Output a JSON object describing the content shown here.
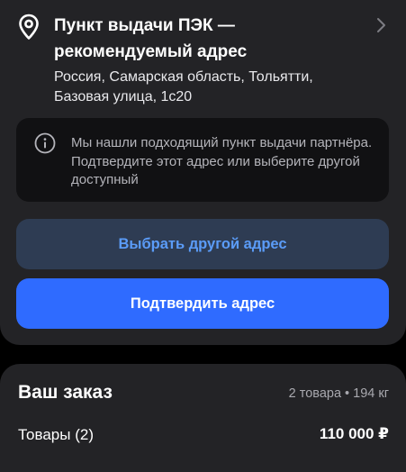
{
  "pickup": {
    "title": "Пункт выдачи ПЭК — рекомендуемый адрес",
    "address": "Россия, Самарская область, Тольятти, Базовая улица, 1с20",
    "icons": {
      "location": "map-pin-icon",
      "navigate": "chevron-right-icon"
    }
  },
  "notice": {
    "icon": "info-icon",
    "text": "Мы нашли подходящий пункт выдачи партнёра. Подтвердите этот адрес или выберите другой доступный"
  },
  "buttons": {
    "choose_other": "Выбрать другой адрес",
    "confirm": "Подтвердить адрес"
  },
  "order": {
    "title": "Ваш заказ",
    "meta": "2 товара • 194 кг",
    "goods_label": "Товары (2)",
    "goods_price": "110 000 ₽"
  },
  "colors": {
    "background": "#000000",
    "card": "#232326",
    "notice_bg": "#111113",
    "primary": "#2f6bff",
    "secondary_bg": "#2e3c53",
    "secondary_text": "#5b9cf8"
  }
}
